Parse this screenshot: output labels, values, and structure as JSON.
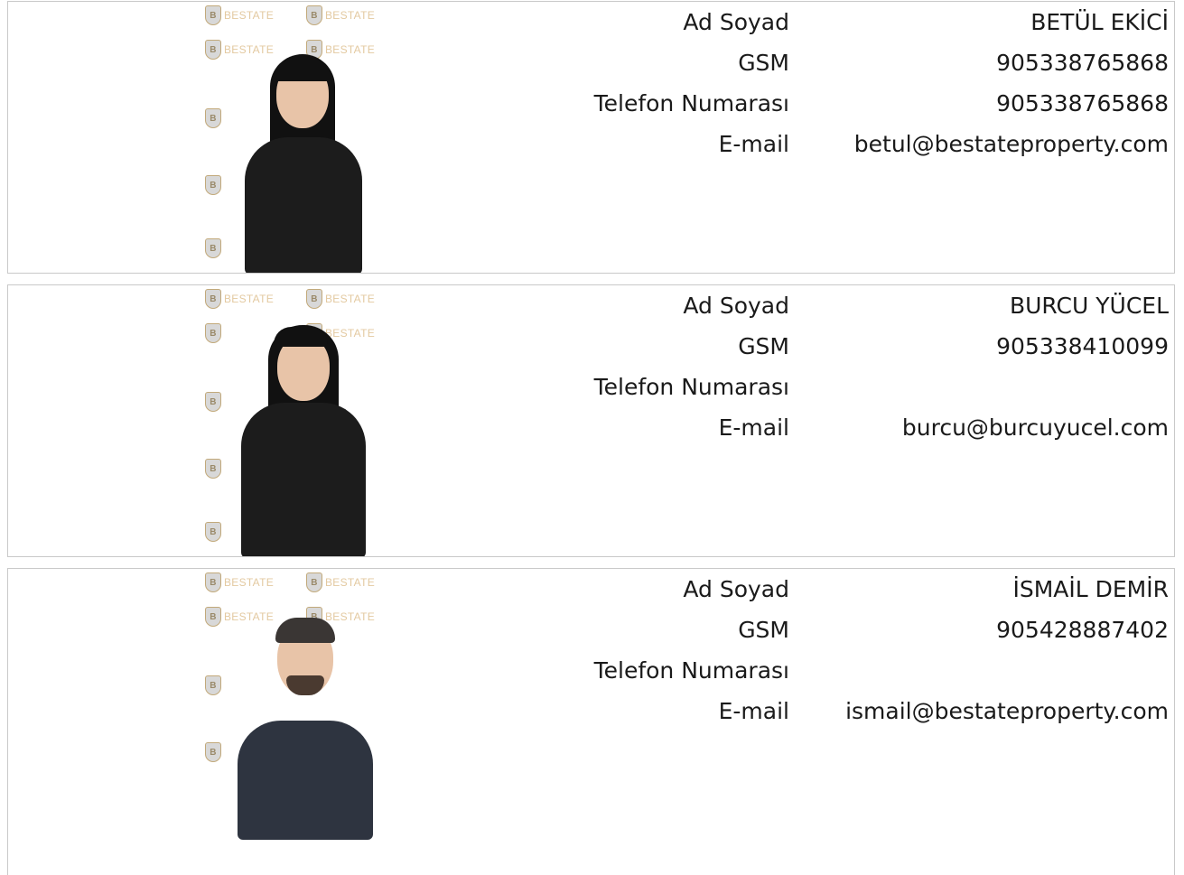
{
  "watermark": {
    "brand": "BESTATE",
    "shield_letter": "B"
  },
  "labels": {
    "name": "Ad Soyad",
    "gsm": "GSM",
    "phone": "Telefon Numarası",
    "email": "E-mail"
  },
  "agents": [
    {
      "name": "BETÜL EKİCİ",
      "gsm": "905338765868",
      "phone": "905338765868",
      "email": "betul@bestateproperty.com"
    },
    {
      "name": "BURCU YÜCEL",
      "gsm": "905338410099",
      "phone": "",
      "email": "burcu@burcuyucel.com"
    },
    {
      "name": "İSMAİL DEMİR",
      "gsm": "905428887402",
      "phone": "",
      "email": "ismail@bestateproperty.com"
    }
  ],
  "colors": {
    "border": "#c9c9c9",
    "watermark": "#e3c9a0",
    "text": "#1a1a1a"
  }
}
